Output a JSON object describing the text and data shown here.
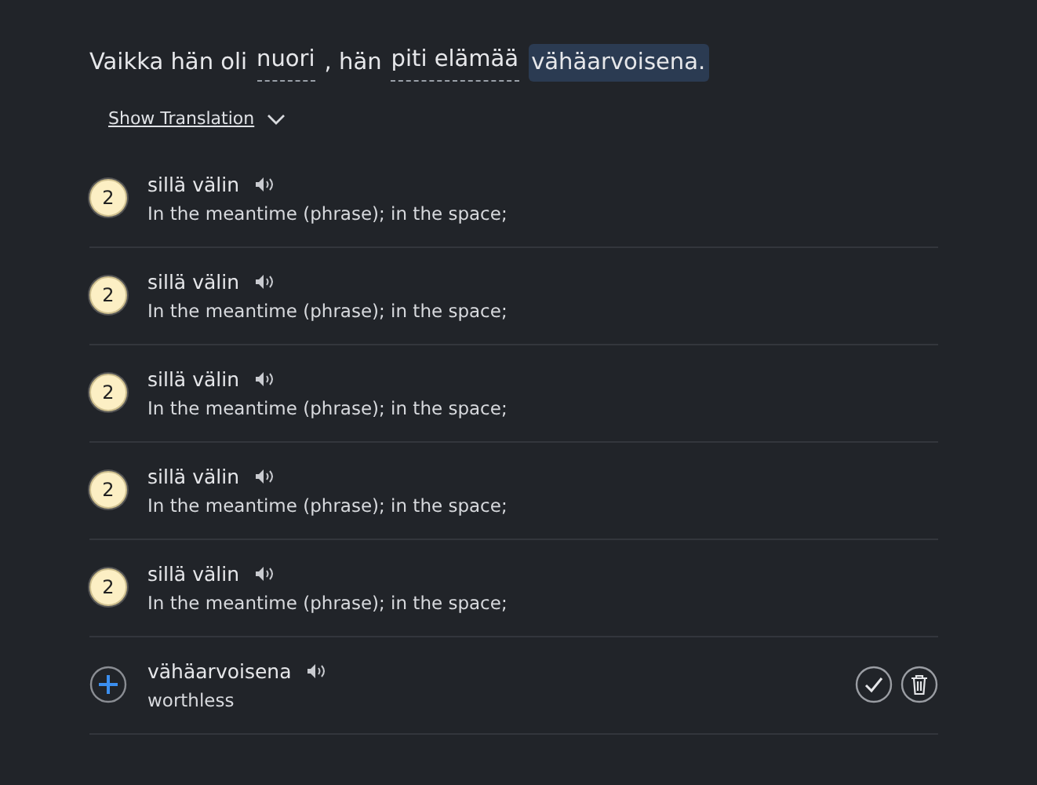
{
  "sentence": [
    {
      "text": "Vaikka hän oli",
      "kind": "plain"
    },
    {
      "text": "nuori",
      "kind": "underlined"
    },
    {
      "text": ", hän",
      "kind": "plain"
    },
    {
      "text": "piti elämää",
      "kind": "underlined"
    },
    {
      "text": "vähäarvoisena.",
      "kind": "highlighted"
    }
  ],
  "translation_toggle": {
    "label": "Show Translation",
    "expanded": false
  },
  "words": [
    {
      "kind": "known",
      "badge": "2",
      "term": "sillä välin",
      "meaning": "In the meantime (phrase); in the space;"
    },
    {
      "kind": "known",
      "badge": "2",
      "term": "sillä välin",
      "meaning": "In the meantime (phrase); in the space;"
    },
    {
      "kind": "known",
      "badge": "2",
      "term": "sillä välin",
      "meaning": "In the meantime (phrase); in the space;"
    },
    {
      "kind": "known",
      "badge": "2",
      "term": "sillä välin",
      "meaning": "In the meantime (phrase); in the space;"
    },
    {
      "kind": "known",
      "badge": "2",
      "term": "sillä välin",
      "meaning": "In the meantime (phrase); in the space;"
    },
    {
      "kind": "new",
      "term": "vähäarvoisena",
      "meaning": "worthless"
    }
  ]
}
